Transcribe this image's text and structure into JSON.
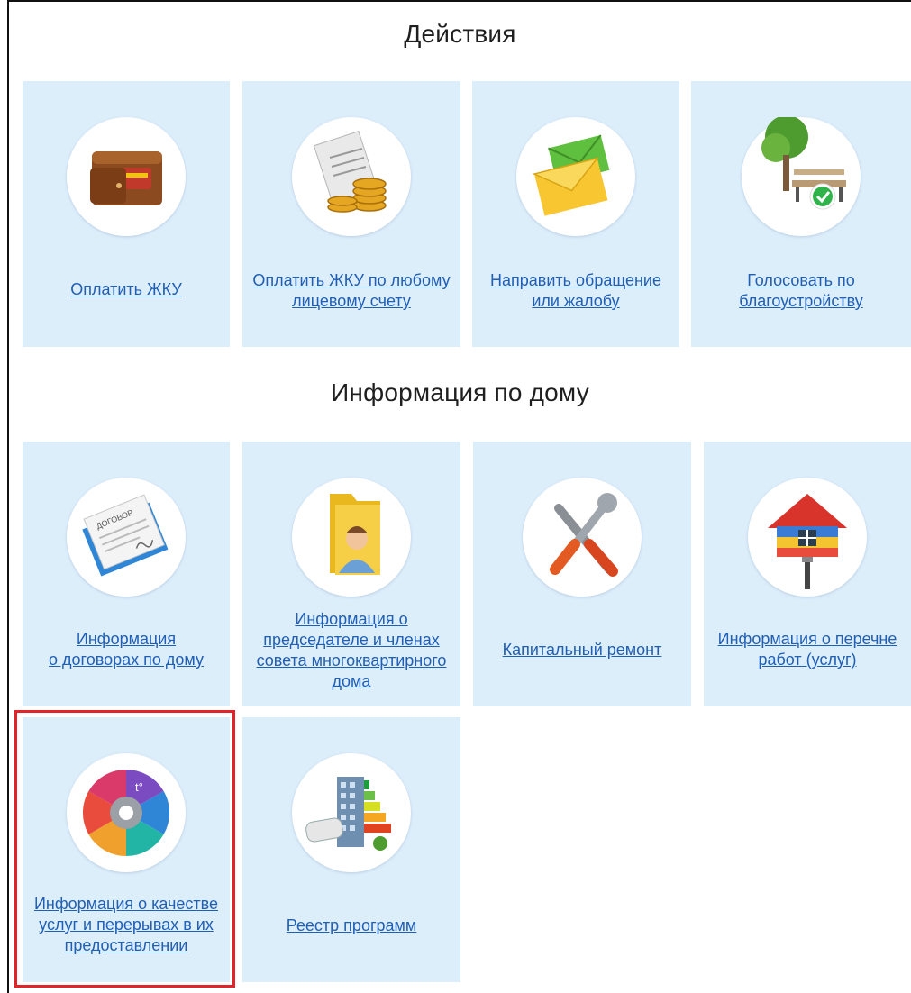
{
  "sections": [
    {
      "title": "Действия"
    },
    {
      "title": "Информация по дому"
    }
  ],
  "tiles": [
    {
      "label": "Оплатить ЖКУ",
      "icon": "wallet-icon"
    },
    {
      "label": "Оплатить ЖКУ по любому\nлицевому счету",
      "icon": "coins-invoice-icon"
    },
    {
      "label": "Направить обращение\nили жалобу",
      "icon": "envelope-icon"
    },
    {
      "label": "Голосовать по\nблагоустройству",
      "icon": "tree-bench-check-icon"
    },
    {
      "label": "Информация \nо договорах по дому",
      "icon": "contract-document-icon",
      "icon_text": "ДОГОВОР"
    },
    {
      "label": "Информация о\nпредседателе и членах\nсовета многоквартирного\nдома",
      "icon": "folder-person-icon"
    },
    {
      "label": "Капитальный ремонт",
      "icon": "wrench-screwdriver-icon"
    },
    {
      "label": "Информация о перечне\nработ (услуг)",
      "icon": "house-paint-roller-icon"
    },
    {
      "label": "Информация о качестве\nуслуг и перерывах в их\nпредоставлении",
      "icon": "utilities-gear-wheel-icon",
      "icon_text": "t°"
    },
    {
      "label": "Реестр программ",
      "icon": "building-energy-plan-icon"
    }
  ],
  "colors": {
    "tile_bg": "#ddeefb",
    "link": "#1f5fb5",
    "highlight": "#e2242a"
  }
}
